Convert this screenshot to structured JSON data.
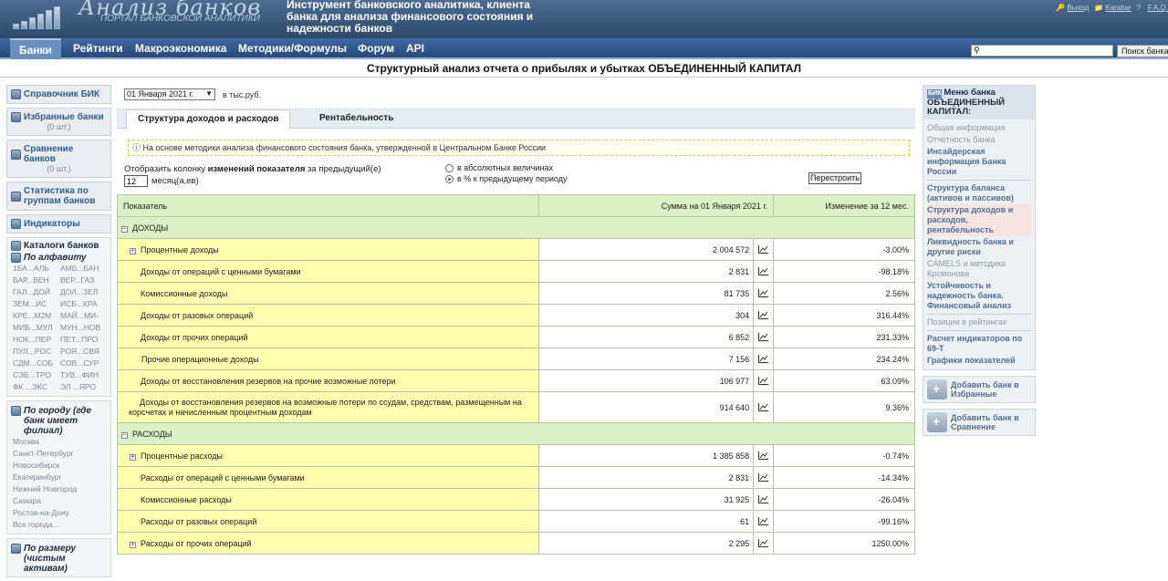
{
  "header": {
    "logo_title": "Анализ банков",
    "logo_subtitle": "ПОРТАЛ БАНКОВСКОЙ АНАЛИТИКИ",
    "tagline": "Инструмент банковского аналитика, клиента банка для анализа финансового состояния и надежности банков",
    "user_links": [
      {
        "icon": "key-icon",
        "label": "Выход"
      },
      {
        "icon": "folder-icon",
        "label": "Karabar"
      },
      {
        "icon": "help-icon",
        "label": "F.A.Q."
      }
    ]
  },
  "nav": {
    "items": [
      "Банки",
      "Рейтинги",
      "Макроэкономика",
      "Методики/Формулы",
      "Форум",
      "API"
    ],
    "active": "Банки",
    "search_placeholder": "",
    "search_button": "Поиск банка"
  },
  "page_title": "Структурный анализ отчета о прибылях и убытках ОБЪЕДИНЕННЫЙ КАПИТАЛ",
  "left": {
    "boxes": [
      {
        "label": "Справочник БИК",
        "count": ""
      },
      {
        "label": "Избранные банки",
        "count": "(0 шт.)"
      },
      {
        "label": "Сравнение банков",
        "count": "(0 шт.)"
      },
      {
        "label": "Статистика по группам банков",
        "count": ""
      },
      {
        "label": "Индикаторы",
        "count": ""
      }
    ],
    "catalogs_title": "Каталоги банков",
    "by_alpha_title": "По алфавиту",
    "alpha": [
      "1БА...АЛЬ",
      "АМБ...БАН",
      "БАР...ВЕН",
      "ВЕР...ГАЗ",
      "ГАЛ...ДОЙ",
      "ДОЛ...ЗЕЛ",
      "ЗЕМ...ИС",
      "ИСБ...КРА",
      "КРЕ...М2М",
      "МАЙ...МИ-",
      "МИБ...МУЛ",
      "МУН...НОВ",
      "НОК...ПЕР",
      "ПЕТ...ПРО",
      "ПУЛ...РОС",
      "РОЯ...СВЯ",
      "СДМ...СОБ",
      "СОВ...СУР",
      "СЭБ...ТРО",
      "ТУВ...ФИН",
      "ФК ...ЭКС",
      "ЭЛ ...ЯРО"
    ],
    "by_city_title": "По городу (где банк имеет филиал)",
    "cities": [
      "Москва",
      "Санкт-Петербург",
      "Новосибирск",
      "Екатеринбург",
      "Нижний Новгород",
      "Самара",
      "Ростов-на-Дону",
      "Все города..."
    ],
    "by_size_title": "По размеру (чистым активам)"
  },
  "main": {
    "date_select": "01 Января 2021 г.",
    "units": "в тыс.руб.",
    "tabs": [
      "Структура доходов и расходов",
      "Рентабельность"
    ],
    "note": "На основе методики анализа финансового состояния банка, утвержденной в Центральном Банке России",
    "show_column_prefix": "Отобразить колонку ",
    "show_column_bold": "изменений показателя",
    "show_column_suffix": " за предыдущий(е)",
    "months_value": "12",
    "months_label": "месяц(а,ев)",
    "radio_abs": "в абсолютных величинах",
    "radio_pct": "в % к предыдущему периоду",
    "rebuild": "Перестроить",
    "table": {
      "col_name": "Показатель",
      "col_sum": "Сумма на 01 Января 2021 г.",
      "col_change": "Изменение за 12 мес.",
      "groups": [
        {
          "title": "ДОХОДЫ",
          "rows": [
            {
              "name": "Процентные доходы",
              "expand": true,
              "indent": 0,
              "sum": "2 004 572",
              "change": "-3.00%",
              "sign": "neg"
            },
            {
              "name": "Доходы от операций с ценными бумагами",
              "expand": false,
              "indent": 1,
              "sum": "2 831",
              "change": "-98.18%",
              "sign": "neg"
            },
            {
              "name": "Комиссионные доходы",
              "expand": false,
              "indent": 1,
              "sum": "81 735",
              "change": "2.56%",
              "sign": "pos"
            },
            {
              "name": "Доходы от разовых операций",
              "expand": false,
              "indent": 1,
              "sum": "304",
              "change": "316.44%",
              "sign": "pos"
            },
            {
              "name": "Доходы от прочих операций",
              "expand": false,
              "indent": 1,
              "sum": "6 852",
              "change": "231.33%",
              "sign": "pos"
            },
            {
              "name": "Прочие операционные доходы",
              "expand": false,
              "indent": 2,
              "sum": "7 156",
              "change": "234.24%",
              "sign": "pos"
            },
            {
              "name": "Доходы от восстановления резервов на прочие возможные потери",
              "expand": false,
              "indent": 1,
              "sum": "106 977",
              "change": "63.09%",
              "sign": "pos"
            },
            {
              "name": "Доходы от восстановления резервов на возможные потери по ссудам, средствам, размещенным на корсчетах и начисленным процентным доходам",
              "expand": false,
              "indent": 1,
              "sum": "914 640",
              "change": "9.36%",
              "sign": "pos"
            }
          ]
        },
        {
          "title": "РАСХОДЫ",
          "rows": [
            {
              "name": "Процентные расходы",
              "expand": true,
              "indent": 0,
              "sum": "1 385 858",
              "change": "-0.74%",
              "sign": "neg"
            },
            {
              "name": "Расходы от операций с ценными бумагами",
              "expand": false,
              "indent": 1,
              "sum": "2 831",
              "change": "-14.34%",
              "sign": "neg"
            },
            {
              "name": "Комиссионные расходы",
              "expand": false,
              "indent": 1,
              "sum": "31 925",
              "change": "-26.04%",
              "sign": "neg"
            },
            {
              "name": "Расходы от разовых операций",
              "expand": false,
              "indent": 1,
              "sum": "61",
              "change": "-99.16%",
              "sign": "neg"
            },
            {
              "name": "Расходы от прочих операций",
              "expand": true,
              "indent": 0,
              "sum": "2 295",
              "change": "1250.00%",
              "sign": "pos"
            }
          ]
        }
      ]
    }
  },
  "right": {
    "menu_title": "Меню банка ОБЪЕДИНЕННЫЙ КАПИТАЛ:",
    "logo_text": "БИК",
    "items": [
      {
        "label": "Общая информация",
        "style": "plain"
      },
      {
        "label": "Отчетность банка",
        "style": "plain"
      },
      {
        "label": "Инсайдерская информация Банка России",
        "style": "bold"
      },
      {
        "label": "---",
        "style": "sep"
      },
      {
        "label": "Структура баланса (активов и пассивов)",
        "style": "bold"
      },
      {
        "label": "Структура доходов и расходов, рентабельность",
        "style": "selected"
      },
      {
        "label": "Ликвидность банка и другие риски",
        "style": "bold"
      },
      {
        "label": "CAMELS и методика Кромонова",
        "style": "plain"
      },
      {
        "label": "Устойчивость и надежность банка. Финансовый анализ",
        "style": "bold"
      },
      {
        "label": "---",
        "style": "sep"
      },
      {
        "label": "Позиции в рейтингах",
        "style": "plain"
      },
      {
        "label": "---",
        "style": "sep"
      },
      {
        "label": "Расчет индикаторов по 69-Т",
        "style": "bold"
      },
      {
        "label": "Графики показателей",
        "style": "bold"
      }
    ],
    "add_fav": "Добавить банк в Избранные",
    "add_cmp": "Добавить банк в Сравнение"
  }
}
